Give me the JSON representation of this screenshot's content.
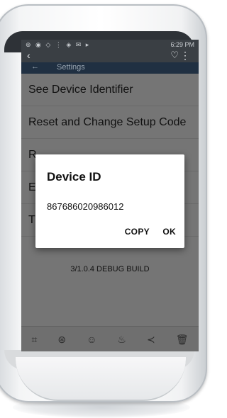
{
  "status_bar": {
    "left_icons": "⊕ ◉ ◇ ⋮ ◈ ✉ ▸",
    "time": "6:29 PM"
  },
  "top_bar": {
    "back_icon": "back-arrow-icon",
    "heart_icon": "heart-icon",
    "overflow_icon": "overflow-menu-icon"
  },
  "app_bar": {
    "back_glyph": "←",
    "title": "Settings"
  },
  "settings_list": [
    {
      "label": "See Device Identifier"
    },
    {
      "label": "Reset and Change Setup Code"
    },
    {
      "label": "R"
    },
    {
      "label": "E"
    },
    {
      "label": "T"
    }
  ],
  "build_label": "3/1.0.4 DEBUG BUILD",
  "dialog": {
    "title": "Device ID",
    "message": "867686020986012",
    "copy_label": "COPY",
    "ok_label": "OK"
  },
  "toolbar_icons": [
    "crop-icon",
    "filter-icon",
    "sticker-icon",
    "paint-icon",
    "share-icon",
    "delete-icon"
  ]
}
